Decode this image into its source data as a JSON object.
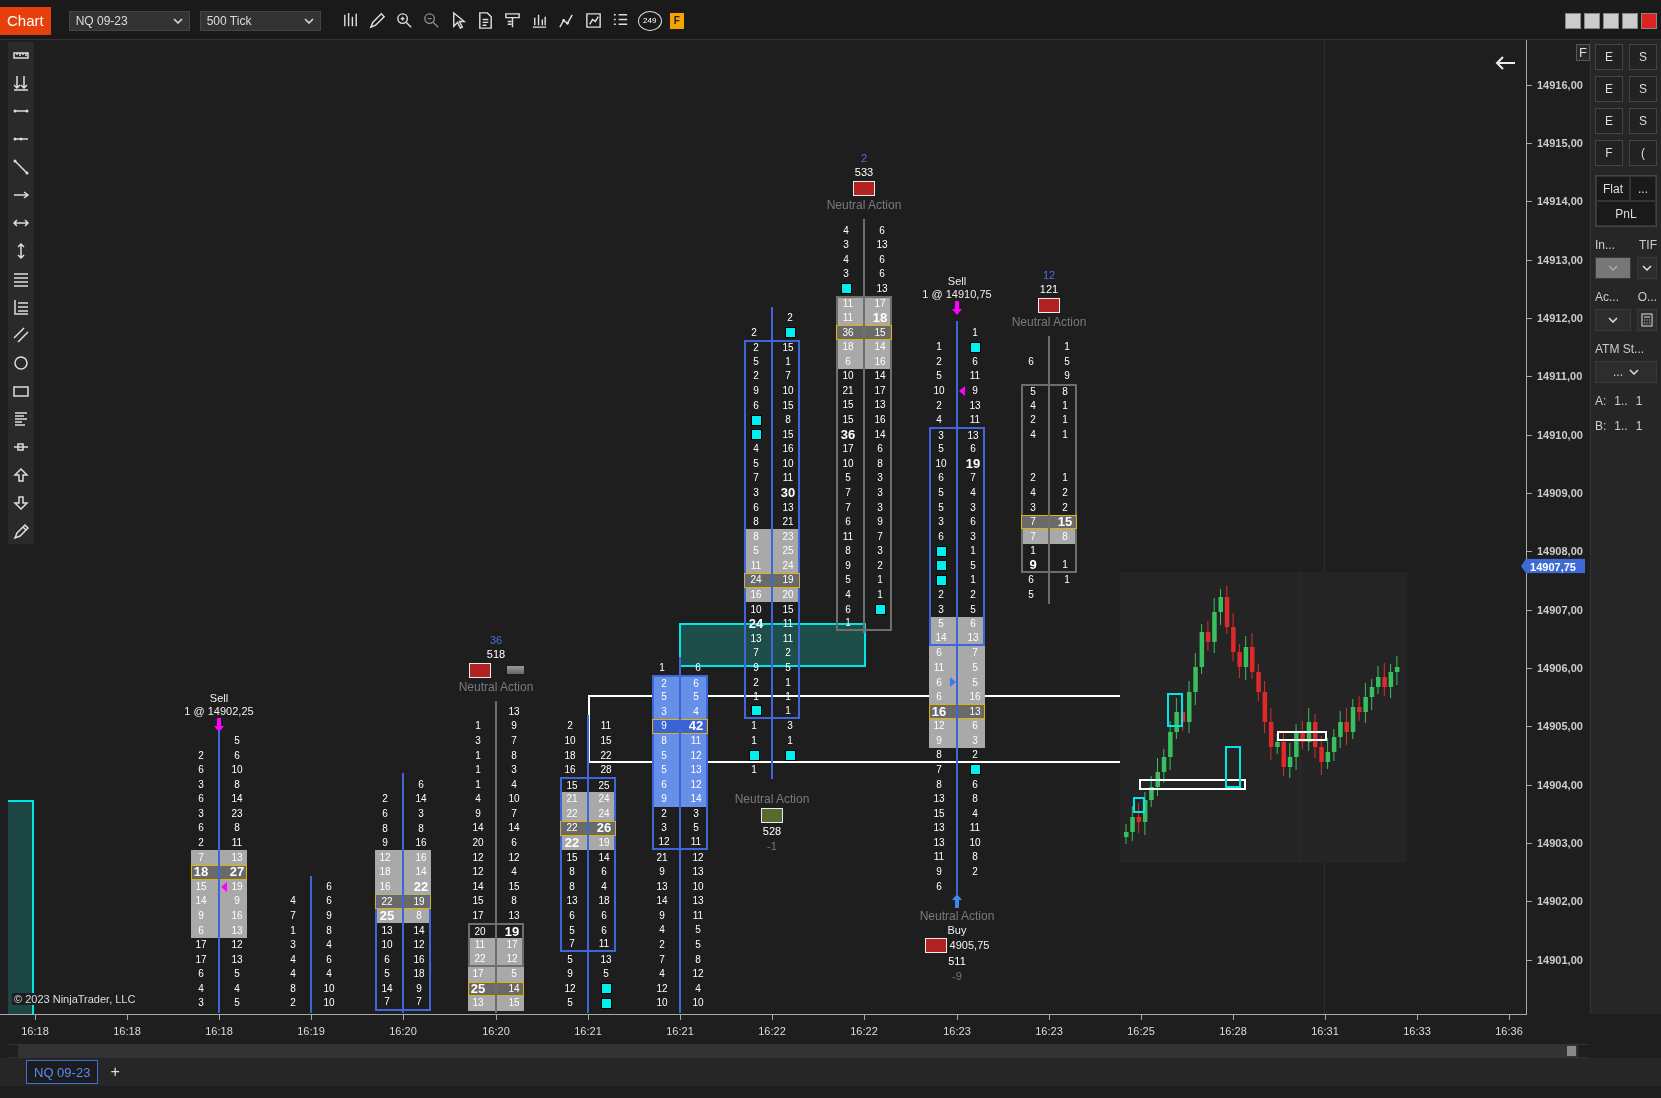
{
  "toolbar": {
    "tab": "Chart",
    "instrument": "NQ 09-23",
    "interval": "500 Tick",
    "badge": "249",
    "flag": "F"
  },
  "chart": {
    "corner_button": "F",
    "copyright": "© 2023 NinjaTrader, LLC",
    "bars": [
      {
        "color": "#3f66d9",
        "trades": [
          {
            "kind": "sell",
            "label": "Sell",
            "detail": "1 @ 14902,25"
          }
        ],
        "rows": [
          {
            "ask": "5",
            "kind": "plain"
          },
          {
            "bid": "2",
            "ask": "6",
            "kind": "plain"
          },
          {
            "bid": "6",
            "ask": "10",
            "kind": "plain"
          },
          {
            "bid": "3",
            "ask": "8",
            "kind": "plain"
          },
          {
            "bid": "6",
            "ask": "14",
            "kind": "plain"
          },
          {
            "bid": "3",
            "ask": "23",
            "kind": "plain"
          },
          {
            "bid": "6",
            "ask": "8",
            "kind": "plain"
          },
          {
            "bid": "2",
            "ask": "11",
            "kind": "plain"
          },
          {
            "bid": "7",
            "ask": "13",
            "kind": "gray"
          },
          {
            "bid": "18",
            "ask": "27",
            "kind": "poc",
            "bid_bold": true,
            "ask_bold": true
          },
          {
            "bid": "15",
            "ask": "19",
            "kind": "gray",
            "sell_pointer": true
          },
          {
            "bid": "14",
            "ask": "9",
            "kind": "gray"
          },
          {
            "bid": "9",
            "ask": "16",
            "kind": "gray"
          },
          {
            "bid": "6",
            "ask": "13",
            "kind": "gray"
          },
          {
            "bid": "17",
            "ask": "12",
            "kind": "plain"
          },
          {
            "bid": "17",
            "ask": "13",
            "kind": "plain"
          },
          {
            "bid": "6",
            "ask": "5",
            "kind": "plain"
          },
          {
            "bid": "4",
            "ask": "4",
            "kind": "plain"
          },
          {
            "bid": "3",
            "ask": "5",
            "kind": "plain"
          }
        ]
      },
      {
        "color": "#3f66d9",
        "rows": [
          {
            "ask": "6",
            "kind": "plain"
          },
          {
            "bid": "4",
            "ask": "6",
            "kind": "plain"
          },
          {
            "bid": "7",
            "ask": "9",
            "kind": "plain"
          },
          {
            "bid": "1",
            "ask": "8",
            "kind": "plain"
          },
          {
            "bid": "3",
            "ask": "4",
            "kind": "plain"
          },
          {
            "bid": "4",
            "ask": "6",
            "kind": "plain"
          },
          {
            "bid": "4",
            "ask": "4",
            "kind": "plain"
          },
          {
            "bid": "8",
            "ask": "10",
            "kind": "plain"
          },
          {
            "bid": "2",
            "ask": "10",
            "kind": "plain"
          }
        ]
      },
      {
        "color": "#3f66d9",
        "rows": [
          {
            "ask": "6",
            "kind": "plain"
          },
          {
            "bid": "2",
            "ask": "14",
            "kind": "plain"
          },
          {
            "bid": "6",
            "ask": "3",
            "kind": "plain"
          },
          {
            "bid": "8",
            "ask": "8",
            "kind": "plain"
          },
          {
            "bid": "9",
            "ask": "16",
            "kind": "plain"
          },
          {
            "bid": "12",
            "ask": "16",
            "kind": "gray"
          },
          {
            "bid": "18",
            "ask": "14",
            "kind": "gray"
          },
          {
            "bid": "16",
            "ask": "22",
            "kind": "gray",
            "ask_bold": true
          },
          {
            "bid": "22",
            "ask": "19",
            "kind": "poc",
            "body": true
          },
          {
            "bid": "25",
            "ask": "8",
            "kind": "gray",
            "bid_bold": true,
            "body": true
          },
          {
            "bid": "13",
            "ask": "14",
            "kind": "plain",
            "body": true
          },
          {
            "bid": "10",
            "ask": "12",
            "kind": "plain",
            "body": true
          },
          {
            "bid": "6",
            "ask": "16",
            "kind": "plain",
            "body": true
          },
          {
            "bid": "5",
            "ask": "18",
            "kind": "plain",
            "body": true
          },
          {
            "bid": "14",
            "ask": "9",
            "kind": "plain",
            "body": true
          },
          {
            "bid": "7",
            "ask": "7",
            "kind": "plain",
            "body": true
          }
        ]
      },
      {
        "color": "#6e6e6e",
        "stats": {
          "kind": "above",
          "delta": "36",
          "volume": "518",
          "color": "#b22222",
          "second_swatch": true,
          "text": "Neutral Action"
        },
        "rows": [
          {
            "ask": "13",
            "kind": "plain"
          },
          {
            "bid": "1",
            "ask": "9",
            "kind": "plain"
          },
          {
            "bid": "3",
            "ask": "7",
            "kind": "plain"
          },
          {
            "bid": "1",
            "ask": "8",
            "kind": "plain"
          },
          {
            "bid": "1",
            "ask": "3",
            "kind": "plain"
          },
          {
            "bid": "1",
            "ask": "4",
            "kind": "plain"
          },
          {
            "bid": "4",
            "ask": "10",
            "kind": "plain"
          },
          {
            "bid": "9",
            "ask": "7",
            "kind": "plain"
          },
          {
            "bid": "14",
            "ask": "14",
            "kind": "plain"
          },
          {
            "bid": "20",
            "ask": "6",
            "kind": "plain"
          },
          {
            "bid": "12",
            "ask": "12",
            "kind": "plain"
          },
          {
            "bid": "12",
            "ask": "4",
            "kind": "plain"
          },
          {
            "bid": "14",
            "ask": "15",
            "kind": "plain"
          },
          {
            "bid": "15",
            "ask": "8",
            "kind": "plain"
          },
          {
            "bid": "17",
            "ask": "13",
            "kind": "plain"
          },
          {
            "bid": "20",
            "ask": "19",
            "kind": "plain",
            "ask_bold": true,
            "body": true
          },
          {
            "bid": "11",
            "ask": "17",
            "kind": "gray",
            "body": true
          },
          {
            "bid": "22",
            "ask": "12",
            "kind": "gray",
            "body": true
          },
          {
            "bid": "17",
            "ask": "5",
            "kind": "gray"
          },
          {
            "bid": "25",
            "ask": "14",
            "kind": "poc",
            "bid_bold": true
          },
          {
            "bid": "13",
            "ask": "15",
            "kind": "gray"
          }
        ]
      },
      {
        "color": "#3f66d9",
        "rows": [
          {
            "bid": "2",
            "ask": "11",
            "kind": "plain"
          },
          {
            "bid": "10",
            "ask": "15",
            "kind": "plain"
          },
          {
            "bid": "18",
            "ask": "22",
            "kind": "plain"
          },
          {
            "bid": "16",
            "ask": "28",
            "kind": "plain"
          },
          {
            "bid": "15",
            "ask": "25",
            "kind": "plain",
            "body": true
          },
          {
            "bid": "21",
            "ask": "24",
            "kind": "gray",
            "body": true
          },
          {
            "bid": "22",
            "ask": "24",
            "kind": "gray",
            "body": true
          },
          {
            "bid": "22",
            "ask": "26",
            "kind": "poc",
            "ask_bold": true,
            "body": true
          },
          {
            "bid": "22",
            "ask": "19",
            "kind": "gray",
            "bid_bold": true,
            "body": true
          },
          {
            "bid": "15",
            "ask": "14",
            "kind": "plain",
            "body": true
          },
          {
            "bid": "8",
            "ask": "6",
            "kind": "plain",
            "body": true
          },
          {
            "bid": "8",
            "ask": "4",
            "kind": "plain",
            "body": true
          },
          {
            "bid": "13",
            "ask": "18",
            "kind": "plain",
            "body": true
          },
          {
            "bid": "6",
            "ask": "6",
            "kind": "plain",
            "body": true
          },
          {
            "bid": "5",
            "ask": "6",
            "kind": "plain",
            "body": true
          },
          {
            "bid": "7",
            "ask": "11",
            "kind": "plain",
            "body": true
          },
          {
            "bid": "5",
            "ask": "13",
            "kind": "plain"
          },
          {
            "bid": "9",
            "ask": "5",
            "kind": "plain"
          },
          {
            "bid": "12",
            "ask_marker": true,
            "kind": "plain"
          },
          {
            "bid": "5",
            "ask_marker": true,
            "kind": "plain"
          }
        ]
      },
      {
        "color": "#3f66d9",
        "rows": [
          {
            "bid": "1",
            "ask": "6",
            "kind": "plain"
          },
          {
            "bid": "2",
            "ask": "6",
            "kind": "blue",
            "body": true
          },
          {
            "bid": "5",
            "ask": "5",
            "kind": "blue",
            "body": true
          },
          {
            "bid": "3",
            "ask": "4",
            "kind": "blue",
            "body": true
          },
          {
            "bid": "9",
            "ask": "42",
            "kind": "poc_blue",
            "ask_bold": true,
            "body": true
          },
          {
            "bid": "8",
            "ask": "11",
            "kind": "blue",
            "body": true
          },
          {
            "bid": "5",
            "ask": "12",
            "kind": "blue",
            "body": true
          },
          {
            "bid": "5",
            "ask": "13",
            "kind": "blue",
            "body": true
          },
          {
            "bid": "6",
            "ask": "12",
            "kind": "blue",
            "body": true
          },
          {
            "bid": "9",
            "ask": "14",
            "kind": "blue",
            "body": true
          },
          {
            "bid": "2",
            "ask": "3",
            "kind": "plain",
            "body": true
          },
          {
            "bid": "3",
            "ask": "5",
            "kind": "plain",
            "body": true
          },
          {
            "bid": "12",
            "ask": "11",
            "kind": "plain",
            "body": true
          },
          {
            "bid": "21",
            "ask": "12",
            "kind": "plain"
          },
          {
            "bid": "9",
            "ask": "13",
            "kind": "plain"
          },
          {
            "bid": "13",
            "ask": "10",
            "kind": "plain"
          },
          {
            "bid": "14",
            "ask": "13",
            "kind": "plain"
          },
          {
            "bid": "9",
            "ask": "11",
            "kind": "plain"
          },
          {
            "bid": "4",
            "ask": "5",
            "kind": "plain"
          },
          {
            "bid": "2",
            "ask": "5",
            "kind": "plain"
          },
          {
            "bid": "7",
            "ask": "8",
            "kind": "plain"
          },
          {
            "bid": "4",
            "ask": "12",
            "kind": "plain"
          },
          {
            "bid": "12",
            "ask": "4",
            "kind": "plain"
          },
          {
            "bid": "10",
            "ask": "10",
            "kind": "plain"
          }
        ]
      },
      {
        "color": "#3f66d9",
        "stats": {
          "kind": "below",
          "delta": "-1",
          "volume": "528",
          "color": "#556b2f",
          "second_swatch": false,
          "text": "Neutral Action"
        },
        "rows": [
          {
            "ask": "2",
            "kind": "plain"
          },
          {
            "bid": "2",
            "ask_marker": true,
            "kind": "plain"
          },
          {
            "bid": "2",
            "ask": "15",
            "kind": "plain",
            "body": true
          },
          {
            "bid": "5",
            "ask": "1",
            "kind": "plain",
            "body": true
          },
          {
            "bid": "2",
            "ask": "7",
            "kind": "plain",
            "body": true
          },
          {
            "bid": "9",
            "ask": "10",
            "kind": "plain",
            "body": true
          },
          {
            "bid": "6",
            "ask": "15",
            "kind": "plain",
            "body": true
          },
          {
            "bid_marker": true,
            "ask": "8",
            "kind": "plain",
            "body": true
          },
          {
            "bid_marker": true,
            "ask": "15",
            "kind": "plain",
            "body": true
          },
          {
            "bid": "4",
            "ask": "16",
            "kind": "plain",
            "body": true
          },
          {
            "bid": "5",
            "ask": "10",
            "kind": "plain",
            "body": true
          },
          {
            "bid": "7",
            "ask": "11",
            "kind": "plain",
            "body": true
          },
          {
            "bid": "3",
            "ask": "30",
            "kind": "plain",
            "ask_bold": true,
            "body": true
          },
          {
            "bid": "6",
            "ask": "13",
            "kind": "plain",
            "body": true
          },
          {
            "bid": "8",
            "ask": "21",
            "kind": "plain",
            "body": true
          },
          {
            "bid": "8",
            "ask": "23",
            "kind": "gray",
            "body": true
          },
          {
            "bid": "5",
            "ask": "25",
            "kind": "gray",
            "body": true
          },
          {
            "bid": "11",
            "ask": "24",
            "kind": "gray",
            "body": true
          },
          {
            "bid": "24",
            "ask": "19",
            "kind": "poc",
            "body": true
          },
          {
            "bid": "16",
            "ask": "20",
            "kind": "gray",
            "body": true
          },
          {
            "bid": "10",
            "ask": "15",
            "kind": "plain",
            "body": true
          },
          {
            "bid": "24",
            "ask": "11",
            "kind": "plain",
            "bid_bold": true,
            "body": true
          },
          {
            "bid": "13",
            "ask": "11",
            "kind": "plain",
            "body": true
          },
          {
            "bid": "7",
            "ask": "2",
            "kind": "plain",
            "body": true
          },
          {
            "bid": "9",
            "ask": "5",
            "kind": "plain",
            "body": true
          },
          {
            "bid": "2",
            "ask": "1",
            "kind": "plain",
            "body": true
          },
          {
            "bid": "1",
            "ask": "1",
            "kind": "plain",
            "body": true
          },
          {
            "bid_marker": true,
            "ask": "1",
            "kind": "plain",
            "body": true
          },
          {
            "bid": "1",
            "ask": "3",
            "kind": "plain"
          },
          {
            "bid": "1",
            "ask": "1",
            "kind": "plain"
          },
          {
            "bid_marker": true,
            "ask_marker": true,
            "kind": "plain"
          },
          {
            "bid": "1",
            "kind": "plain"
          }
        ]
      },
      {
        "color": "#6e6e6e",
        "stats": {
          "kind": "above",
          "delta": "2",
          "volume": "533",
          "color": "#b22222",
          "second_swatch": false,
          "text": "Neutral Action"
        },
        "rows": [
          {
            "bid": "4",
            "ask": "6",
            "kind": "plain"
          },
          {
            "bid": "3",
            "ask": "13",
            "kind": "plain"
          },
          {
            "bid": "4",
            "ask": "6",
            "kind": "plain"
          },
          {
            "bid": "3",
            "ask": "6",
            "kind": "plain"
          },
          {
            "bid_marker": true,
            "ask": "13",
            "kind": "plain"
          },
          {
            "bid": "11",
            "ask": "17",
            "kind": "gray",
            "body": true
          },
          {
            "bid": "11",
            "ask": "18",
            "kind": "gray",
            "ask_bold": true,
            "body": true
          },
          {
            "bid": "36",
            "ask": "15",
            "kind": "poc",
            "body": true
          },
          {
            "bid": "18",
            "ask": "14",
            "kind": "gray",
            "body": true
          },
          {
            "bid": "6",
            "ask": "16",
            "kind": "gray",
            "body": true
          },
          {
            "bid": "10",
            "ask": "14",
            "kind": "plain",
            "body": true
          },
          {
            "bid": "21",
            "ask": "17",
            "kind": "plain",
            "body": true
          },
          {
            "bid": "15",
            "ask": "13",
            "kind": "plain",
            "body": true
          },
          {
            "bid": "15",
            "ask": "16",
            "kind": "plain",
            "body": true
          },
          {
            "bid": "36",
            "ask": "14",
            "kind": "plain",
            "bid_bold": true,
            "body": true
          },
          {
            "bid": "17",
            "ask": "6",
            "kind": "plain",
            "body": true
          },
          {
            "bid": "10",
            "ask": "8",
            "kind": "plain",
            "body": true
          },
          {
            "bid": "5",
            "ask": "3",
            "kind": "plain",
            "body": true
          },
          {
            "bid": "7",
            "ask": "3",
            "kind": "plain",
            "body": true
          },
          {
            "bid": "7",
            "ask": "3",
            "kind": "plain",
            "body": true
          },
          {
            "bid": "6",
            "ask": "9",
            "kind": "plain",
            "body": true
          },
          {
            "bid": "11",
            "ask": "7",
            "kind": "plain",
            "body": true
          },
          {
            "bid": "8",
            "ask": "3",
            "kind": "plain",
            "body": true
          },
          {
            "bid": "9",
            "ask": "2",
            "kind": "plain",
            "body": true
          },
          {
            "bid": "5",
            "ask": "1",
            "kind": "plain",
            "body": true
          },
          {
            "bid": "4",
            "ask": "1",
            "kind": "plain",
            "body": true
          },
          {
            "bid": "6",
            "ask_marker": true,
            "kind": "plain",
            "body": true
          },
          {
            "bid": "1",
            "kind": "plain",
            "body": true
          }
        ]
      },
      {
        "color": "#3f66d9",
        "trades": [
          {
            "kind": "sell",
            "label": "Sell",
            "detail": "1 @ 14910,75"
          },
          {
            "kind": "buy",
            "label": "Buy",
            "detail": "4905,75"
          }
        ],
        "stats": {
          "kind": "below",
          "delta": "-9",
          "volume": "511",
          "color": "#b22222",
          "second_swatch": false,
          "text": "Neutral Action"
        },
        "rows": [
          {
            "ask": "1",
            "kind": "plain"
          },
          {
            "bid": "1",
            "ask_marker": true,
            "kind": "plain"
          },
          {
            "bid": "2",
            "ask": "6",
            "kind": "plain"
          },
          {
            "bid": "5",
            "ask": "11",
            "kind": "plain"
          },
          {
            "bid": "10",
            "ask": "9",
            "kind": "plain",
            "sell_pointer": true
          },
          {
            "bid": "2",
            "ask": "13",
            "kind": "plain"
          },
          {
            "bid": "4",
            "ask": "11",
            "kind": "plain"
          },
          {
            "bid": "3",
            "ask": "13",
            "kind": "plain",
            "body": true
          },
          {
            "bid": "5",
            "ask": "6",
            "kind": "plain",
            "body": true
          },
          {
            "bid": "10",
            "ask": "19",
            "kind": "plain",
            "ask_bold": true,
            "body": true
          },
          {
            "bid": "6",
            "ask": "7",
            "kind": "plain",
            "body": true
          },
          {
            "bid": "5",
            "ask": "4",
            "kind": "plain",
            "body": true
          },
          {
            "bid": "5",
            "ask": "3",
            "kind": "plain",
            "body": true
          },
          {
            "bid": "3",
            "ask": "6",
            "kind": "plain",
            "body": true
          },
          {
            "bid": "6",
            "ask": "3",
            "kind": "plain",
            "body": true
          },
          {
            "bid_marker": true,
            "ask": "1",
            "kind": "plain",
            "body": true
          },
          {
            "bid_marker": true,
            "ask": "5",
            "kind": "plain",
            "body": true
          },
          {
            "bid_marker": true,
            "ask": "1",
            "kind": "plain",
            "body": true
          },
          {
            "bid": "2",
            "ask": "2",
            "kind": "plain",
            "body": true
          },
          {
            "bid": "3",
            "ask": "5",
            "kind": "plain",
            "body": true
          },
          {
            "bid": "5",
            "ask": "6",
            "kind": "gray",
            "body": true
          },
          {
            "bid": "14",
            "ask": "13",
            "kind": "gray",
            "body": true
          },
          {
            "bid": "6",
            "ask": "7",
            "kind": "gray"
          },
          {
            "bid": "11",
            "ask": "5",
            "kind": "gray"
          },
          {
            "bid": "6",
            "ask": "5",
            "kind": "gray",
            "buy_pointer": true
          },
          {
            "bid": "6",
            "ask": "16",
            "kind": "gray"
          },
          {
            "bid": "16",
            "ask": "13",
            "kind": "poc",
            "bid_bold": true
          },
          {
            "bid": "12",
            "ask": "6",
            "kind": "gray"
          },
          {
            "bid": "9",
            "ask": "3",
            "kind": "gray"
          },
          {
            "bid": "8",
            "ask": "2",
            "kind": "plain"
          },
          {
            "bid": "7",
            "ask_marker": true,
            "kind": "plain"
          },
          {
            "bid": "8",
            "ask": "6",
            "kind": "plain"
          },
          {
            "bid": "13",
            "ask": "8",
            "kind": "plain"
          },
          {
            "bid": "15",
            "ask": "4",
            "kind": "plain"
          },
          {
            "bid": "13",
            "ask": "11",
            "kind": "plain"
          },
          {
            "bid": "13",
            "ask": "10",
            "kind": "plain"
          },
          {
            "bid": "11",
            "ask": "8",
            "kind": "plain"
          },
          {
            "bid": "9",
            "ask": "2",
            "kind": "plain"
          },
          {
            "bid": "6",
            "kind": "plain"
          }
        ]
      },
      {
        "color": "#6e6e6e",
        "stats": {
          "kind": "above",
          "delta": "12",
          "volume": "121",
          "color": "#b22222",
          "second_swatch": false,
          "text": "Neutral Action"
        },
        "rows": [
          {
            "ask": "1",
            "kind": "plain"
          },
          {
            "bid": "6",
            "ask": "5",
            "kind": "plain"
          },
          {
            "ask": "9",
            "kind": "plain"
          },
          {
            "bid": "5",
            "ask": "8",
            "kind": "plain",
            "body": true
          },
          {
            "bid": "4",
            "ask": "1",
            "kind": "plain",
            "body": true
          },
          {
            "bid": "2",
            "ask": "1",
            "kind": "plain",
            "body": true
          },
          {
            "bid": "4",
            "ask": "1",
            "kind": "plain",
            "body": true
          },
          {
            "kind": "plain",
            "body": true
          },
          {
            "kind": "plain",
            "body": true
          },
          {
            "bid": "2",
            "ask": "1",
            "kind": "plain",
            "body": true
          },
          {
            "bid": "4",
            "ask": "2",
            "kind": "plain",
            "body": true
          },
          {
            "bid": "3",
            "ask": "2",
            "kind": "plain",
            "body": true
          },
          {
            "bid": "7",
            "ask": "15",
            "kind": "poc",
            "ask_bold": true,
            "body": true
          },
          {
            "bid": "7",
            "ask": "8",
            "kind": "gray",
            "body": true
          },
          {
            "bid": "1",
            "kind": "plain",
            "body": true
          },
          {
            "bid": "9",
            "ask": "1",
            "kind": "plain",
            "bid_bold": true,
            "body": true
          },
          {
            "bid": "6",
            "ask": "1",
            "kind": "plain"
          },
          {
            "bid": "5",
            "kind": "plain"
          }
        ]
      }
    ],
    "price_axis": {
      "labels": [
        "14916,00",
        "14915,00",
        "14914,00",
        "14913,00",
        "14912,00",
        "14911,00",
        "14910,00",
        "14909,00",
        "14908,00",
        "14907,00",
        "14906,00",
        "14905,00",
        "14904,00",
        "14903,00",
        "14902,00",
        "14901,00"
      ],
      "current": "14907,75"
    },
    "time_axis": [
      "16:18",
      "16:18",
      "16:18",
      "16:19",
      "16:20",
      "16:20",
      "16:21",
      "16:21",
      "16:22",
      "16:22",
      "16:23",
      "16:23",
      "16:25",
      "16:28",
      "16:31",
      "16:33",
      "16:36"
    ]
  },
  "order_panel": {
    "buttons": [
      {
        "label": "E"
      },
      {
        "label": "S"
      },
      {
        "label": "E"
      },
      {
        "label": "S"
      },
      {
        "label": "E"
      },
      {
        "label": "S"
      },
      {
        "label": "F"
      },
      {
        "label": "("
      }
    ],
    "flat": "Flat",
    "more": "...",
    "pnl": "PnL",
    "rows": [
      {
        "kind": "labels",
        "texts": [
          "In...",
          "TIF"
        ]
      },
      {
        "kind": "controls",
        "items": [
          {
            "kind": "dropdown",
            "disabled": true
          },
          {
            "kind": "dropdown",
            "disabled": false
          }
        ]
      },
      {
        "kind": "labels",
        "texts": [
          "Ac...",
          "O..."
        ]
      },
      {
        "kind": "controls",
        "items": [
          {
            "kind": "dropdown",
            "disabled": false
          },
          {
            "kind": "calculator",
            "disabled": false
          }
        ]
      },
      {
        "kind": "labels",
        "texts": [
          "ATM St..."
        ]
      },
      {
        "kind": "controls",
        "items": [
          {
            "kind": "dropdown",
            "disabled": false,
            "value": "..."
          }
        ]
      },
      {
        "kind": "labels",
        "texts": [
          "A:",
          "1..",
          "1"
        ]
      },
      {
        "kind": "labels",
        "texts": [
          "B:",
          "1..",
          "1"
        ]
      }
    ]
  },
  "tabs": [
    {
      "label": "NQ 09-23",
      "selected": true
    }
  ],
  "add_tab": "+"
}
